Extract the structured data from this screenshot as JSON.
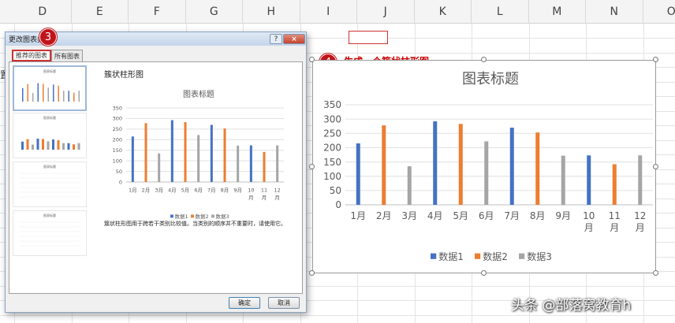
{
  "spreadsheet": {
    "columns": [
      "D",
      "E",
      "F",
      "G",
      "H",
      "I",
      "J",
      "K",
      "L",
      "M",
      "N",
      "O"
    ],
    "left_edge_char": "置"
  },
  "dialog": {
    "title": "更改图表类",
    "help_label": "?",
    "close_label": "×",
    "tabs": [
      "推荐的图表",
      "所有图表"
    ],
    "preview_heading": "簇状柱形图",
    "description": "簇状柱形图用于跨若干类别比较值。当类别的顺序并不重要时，请使用它。",
    "ok_label": "确定",
    "cancel_label": "取消",
    "thumbnail_titles": [
      "图表标题",
      "图表标题",
      "图表标题",
      "图表标题"
    ]
  },
  "steps": {
    "three": "3",
    "four": "4",
    "four_label": "生成一个簇状柱形图"
  },
  "colors": {
    "series1": "#4472c4",
    "series2": "#ed7d31",
    "series3": "#a5a5a5",
    "badge": "#c0141a"
  },
  "chart_data": {
    "type": "bar",
    "title": "图表标题",
    "categories": [
      "1月",
      "2月",
      "3月",
      "4月",
      "5月",
      "6月",
      "7月",
      "8月",
      "9月",
      "10月",
      "11月",
      "12月"
    ],
    "series": [
      {
        "name": "数据1",
        "values": [
          215,
          null,
          null,
          292,
          null,
          null,
          270,
          null,
          null,
          173,
          null,
          null
        ]
      },
      {
        "name": "数据2",
        "values": [
          null,
          278,
          null,
          null,
          283,
          null,
          null,
          253,
          null,
          null,
          142,
          null
        ]
      },
      {
        "name": "数据3",
        "values": [
          null,
          null,
          135,
          null,
          null,
          222,
          null,
          null,
          172,
          null,
          null,
          173
        ]
      }
    ],
    "ylim": [
      0,
      350
    ],
    "yticks": [
      0,
      50,
      100,
      150,
      200,
      250,
      300,
      350
    ],
    "grid": true,
    "legend": "bottom"
  },
  "watermark": "头条 @部落窝教育h"
}
